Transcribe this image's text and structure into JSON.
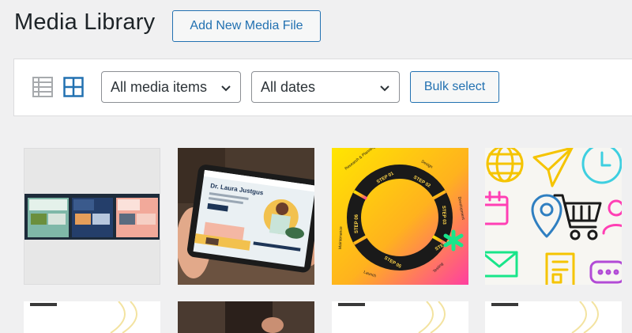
{
  "header": {
    "title": "Media Library",
    "add_new_label": "Add New Media File"
  },
  "toolbar": {
    "list_view_icon": "list-view-icon",
    "grid_view_icon": "grid-view-icon",
    "type_filter": {
      "selected": "All media items"
    },
    "date_filter": {
      "selected": "All dates"
    },
    "bulk_select_label": "Bulk select"
  },
  "thumbnail_text": {
    "tablet_title": "Dr. Laura Justgus",
    "roadmap_steps": [
      "Research & Planning",
      "Design",
      "Development",
      "Testing",
      "Launch",
      "Maintenance"
    ],
    "roadmap_step_numbers": [
      "STEP 01",
      "STEP 02",
      "STEP 03",
      "STEP 04",
      "STEP 05",
      "STEP 06"
    ]
  },
  "colors": {
    "accent": "#2271b1",
    "background": "#f0f0f1",
    "toolbar_bg": "#ffffff",
    "border": "#dcdcde"
  },
  "media_items": [
    {
      "name": "website-mockups",
      "icon": "image-thumbnail"
    },
    {
      "name": "tablet-website",
      "icon": "image-thumbnail"
    },
    {
      "name": "roadmap-circle",
      "icon": "image-thumbnail"
    },
    {
      "name": "icon-pattern",
      "icon": "image-thumbnail"
    },
    {
      "name": "media-item-5",
      "icon": "image-thumbnail"
    },
    {
      "name": "media-item-6",
      "icon": "image-thumbnail"
    },
    {
      "name": "media-item-7",
      "icon": "image-thumbnail"
    },
    {
      "name": "media-item-8",
      "icon": "image-thumbnail"
    }
  ]
}
